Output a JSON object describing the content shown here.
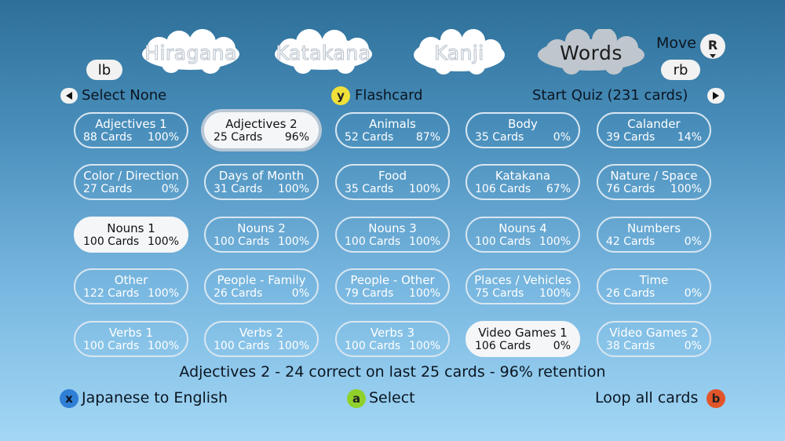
{
  "tabs": [
    {
      "label": "Hiragana",
      "active": false
    },
    {
      "label": "Katakana",
      "active": false
    },
    {
      "label": "Kanji",
      "active": false
    },
    {
      "label": "Words",
      "active": true
    }
  ],
  "bumpers": {
    "left": "lb",
    "right": "rb"
  },
  "move": {
    "label": "Move",
    "button": "R"
  },
  "toolbar": {
    "select_none": "Select None",
    "flashcard_button": "y",
    "flashcard": "Flashcard",
    "start_quiz": "Start Quiz (231 cards)"
  },
  "decks": [
    {
      "name": "Adjectives 1",
      "cards": "88 Cards",
      "pct": "100%",
      "state": "normal"
    },
    {
      "name": "Adjectives 2",
      "cards": "25 Cards",
      "pct": "96%",
      "state": "focus"
    },
    {
      "name": "Animals",
      "cards": "52 Cards",
      "pct": "87%",
      "state": "normal"
    },
    {
      "name": "Body",
      "cards": "35 Cards",
      "pct": "0%",
      "state": "normal"
    },
    {
      "name": "Calander",
      "cards": "39 Cards",
      "pct": "14%",
      "state": "normal"
    },
    {
      "name": "Color / Direction",
      "cards": "27 Cards",
      "pct": "0%",
      "state": "normal"
    },
    {
      "name": "Days of Month",
      "cards": "31 Cards",
      "pct": "100%",
      "state": "normal"
    },
    {
      "name": "Food",
      "cards": "35 Cards",
      "pct": "100%",
      "state": "normal"
    },
    {
      "name": "Katakana",
      "cards": "106 Cards",
      "pct": "67%",
      "state": "normal"
    },
    {
      "name": "Nature / Space",
      "cards": "76 Cards",
      "pct": "100%",
      "state": "normal"
    },
    {
      "name": "Nouns 1",
      "cards": "100 Cards",
      "pct": "100%",
      "state": "selected"
    },
    {
      "name": "Nouns 2",
      "cards": "100 Cards",
      "pct": "100%",
      "state": "normal"
    },
    {
      "name": "Nouns 3",
      "cards": "100 Cards",
      "pct": "100%",
      "state": "normal"
    },
    {
      "name": "Nouns 4",
      "cards": "100 Cards",
      "pct": "100%",
      "state": "normal"
    },
    {
      "name": "Numbers",
      "cards": "42 Cards",
      "pct": "0%",
      "state": "normal"
    },
    {
      "name": "Other",
      "cards": "122 Cards",
      "pct": "100%",
      "state": "normal"
    },
    {
      "name": "People - Family",
      "cards": "26 Cards",
      "pct": "0%",
      "state": "normal"
    },
    {
      "name": "People - Other",
      "cards": "79 Cards",
      "pct": "100%",
      "state": "normal"
    },
    {
      "name": "Places / Vehicles",
      "cards": "75 Cards",
      "pct": "100%",
      "state": "normal"
    },
    {
      "name": "Time",
      "cards": "26 Cards",
      "pct": "0%",
      "state": "normal"
    },
    {
      "name": "Verbs 1",
      "cards": "100 Cards",
      "pct": "100%",
      "state": "normal"
    },
    {
      "name": "Verbs 2",
      "cards": "100 Cards",
      "pct": "100%",
      "state": "normal"
    },
    {
      "name": "Verbs 3",
      "cards": "100 Cards",
      "pct": "100%",
      "state": "normal"
    },
    {
      "name": "Video Games 1",
      "cards": "106 Cards",
      "pct": "0%",
      "state": "selected"
    },
    {
      "name": "Video Games 2",
      "cards": "38 Cards",
      "pct": "0%",
      "state": "normal"
    }
  ],
  "status": "Adjectives 2 - 24 correct on last 25 cards - 96% retention",
  "footer": {
    "x_button": "x",
    "x_label": "Japanese to English",
    "a_button": "a",
    "a_label": "Select",
    "b_button": "b",
    "b_label": "Loop all cards"
  },
  "colors": {
    "x_button": "#2f7fd6",
    "a_button": "#8fd12a",
    "b_button": "#e2552a",
    "y_button": "#f0e03a"
  }
}
